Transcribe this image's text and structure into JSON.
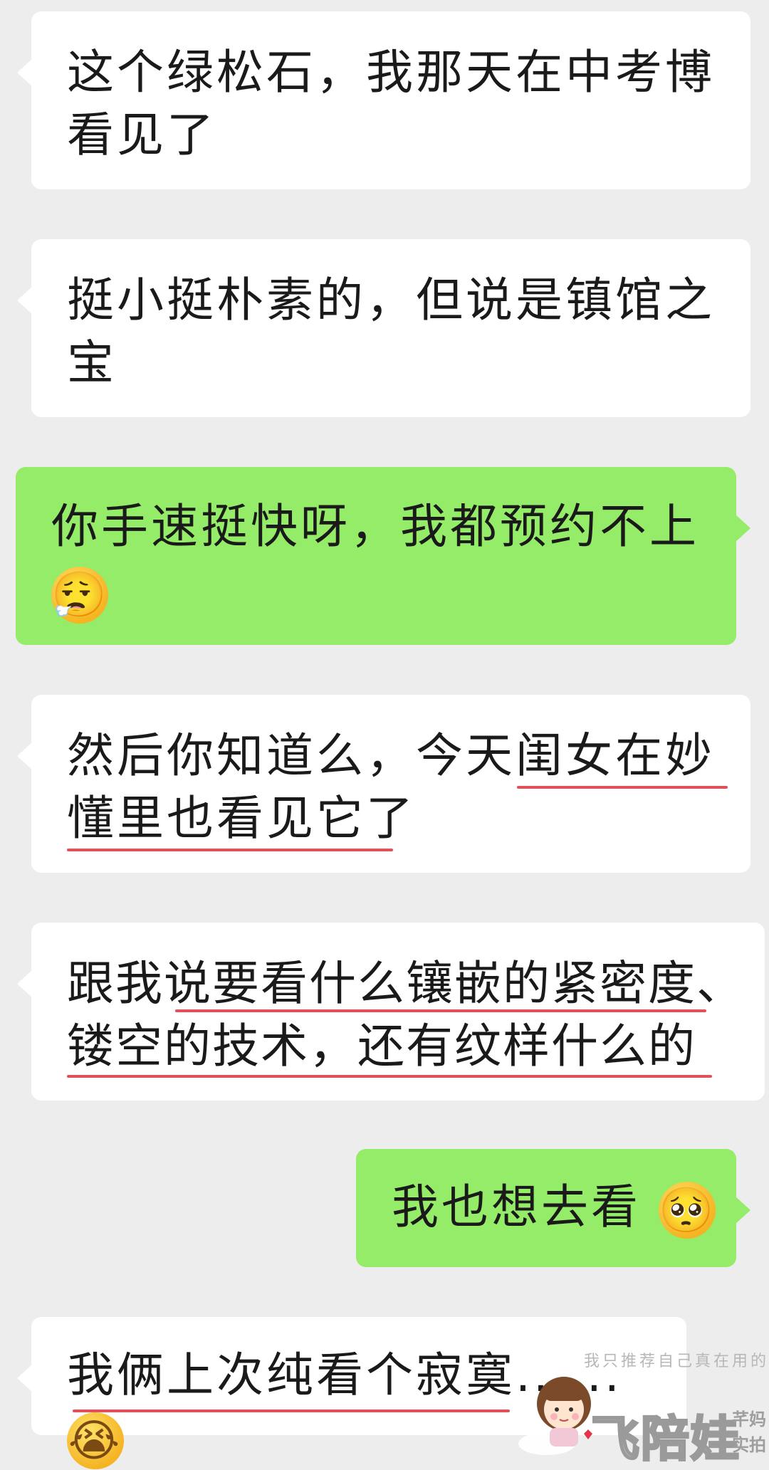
{
  "messages": [
    {
      "side": "received",
      "lines": [
        "这个绿松石，我那天在中考博",
        "看见了"
      ]
    },
    {
      "side": "received",
      "lines": [
        "挺小挺朴素的，但说是镇馆之",
        "宝"
      ]
    },
    {
      "side": "sent",
      "lines": [
        "你手速挺快呀，我都预约不上"
      ],
      "emoji": "😮‍💨"
    },
    {
      "side": "received",
      "lines": [
        "然后你知道么，今天闺女在妙",
        "懂里也看见它了"
      ]
    },
    {
      "side": "received",
      "lines": [
        "跟我说要看什么镶嵌的紧密度、",
        "镂空的技术，还有纹样什么的"
      ]
    },
    {
      "side": "sent",
      "lines": [
        "我也想去看"
      ],
      "emoji": "🥺"
    },
    {
      "side": "received",
      "lines": [
        "我俩上次纯看个寂寞......"
      ],
      "emoji": "😭"
    }
  ],
  "watermark": {
    "tagline": "我只推荐自己真在用的",
    "brand": "飞陪娃",
    "side_top": "芊妈",
    "side_bottom": "实拍"
  },
  "colors": {
    "background": "#ededed",
    "received_bubble": "#ffffff",
    "sent_bubble": "#95ec69",
    "underline": "#e0525a"
  }
}
